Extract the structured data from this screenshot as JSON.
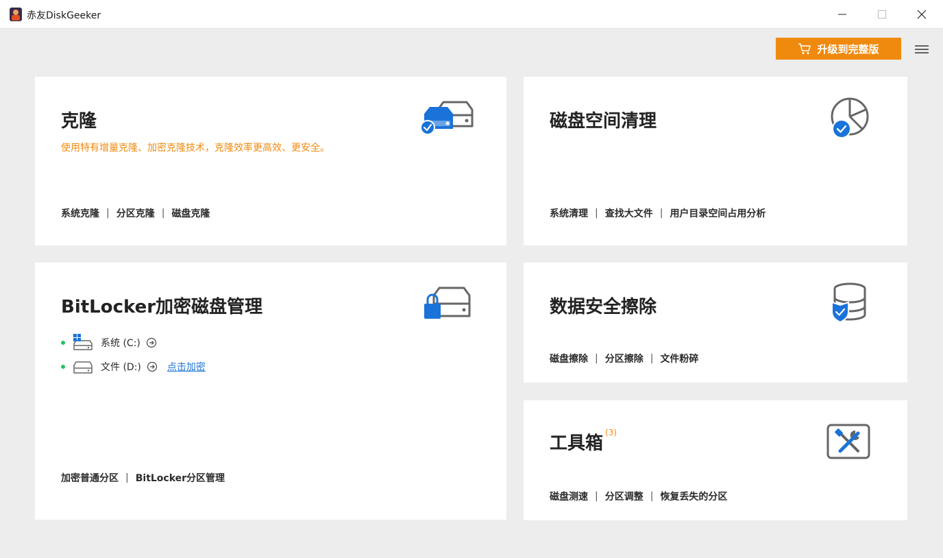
{
  "window": {
    "title": "赤友DiskGeeker"
  },
  "header": {
    "upgrade_label": "升级到完整版"
  },
  "colors": {
    "accent_orange": "#f08a0e",
    "icon_blue": "#1a73d9",
    "status_green": "#25c26a",
    "link_blue": "#1a73d9"
  },
  "cards": {
    "clone": {
      "title": "克隆",
      "subtitle": "使用特有增量克隆、加密克隆技术，克隆效率更高效、更安全。",
      "links": [
        "系统克隆",
        "分区克隆",
        "磁盘克隆"
      ],
      "icon": "drive-clone-icon"
    },
    "clean": {
      "title": "磁盘空间清理",
      "links": [
        "系统清理",
        "查找大文件",
        "用户目录空间占用分析"
      ],
      "icon": "pie-check-icon"
    },
    "bitlocker": {
      "title": "BitLocker加密磁盘管理",
      "drives": [
        {
          "label": "系统 (C:)",
          "icon": "windows-drive-icon"
        },
        {
          "label": "文件 (D:)",
          "icon": "drive-icon",
          "action": "点击加密"
        }
      ],
      "links": [
        "加密普通分区",
        "BitLocker分区管理"
      ],
      "icon": "drive-lock-icon"
    },
    "wipe": {
      "title": "数据安全擦除",
      "links": [
        "磁盘擦除",
        "分区擦除",
        "文件粉碎"
      ],
      "icon": "database-shield-icon"
    },
    "tools": {
      "title": "工具箱",
      "badge": "(3)",
      "links": [
        "磁盘测速",
        "分区调整",
        "恢复丢失的分区"
      ],
      "icon": "toolbox-icon"
    }
  }
}
